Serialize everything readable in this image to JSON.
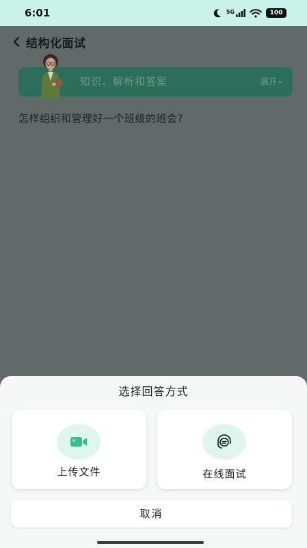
{
  "status_bar": {
    "time": "6:01",
    "network": "5G",
    "battery": "100"
  },
  "header": {
    "title": "结构化面试",
    "back_icon": "chevron-left-icon"
  },
  "banner": {
    "label": "知识、解析和答案",
    "expand": "展开",
    "colors": {
      "background": "#2b6e59",
      "text": "#6e9a89"
    }
  },
  "question": {
    "text": "怎样组织和管理好一个班级的班会?"
  },
  "sheet": {
    "title": "选择回答方式",
    "options": [
      {
        "label": "上传文件",
        "icon": "video-camera-icon"
      },
      {
        "label": "在线面试",
        "icon": "headset-chat-icon"
      }
    ],
    "cancel": "取消",
    "colors": {
      "icon_bg": "#dff6ee",
      "icon_accent": "#34c18f"
    }
  }
}
